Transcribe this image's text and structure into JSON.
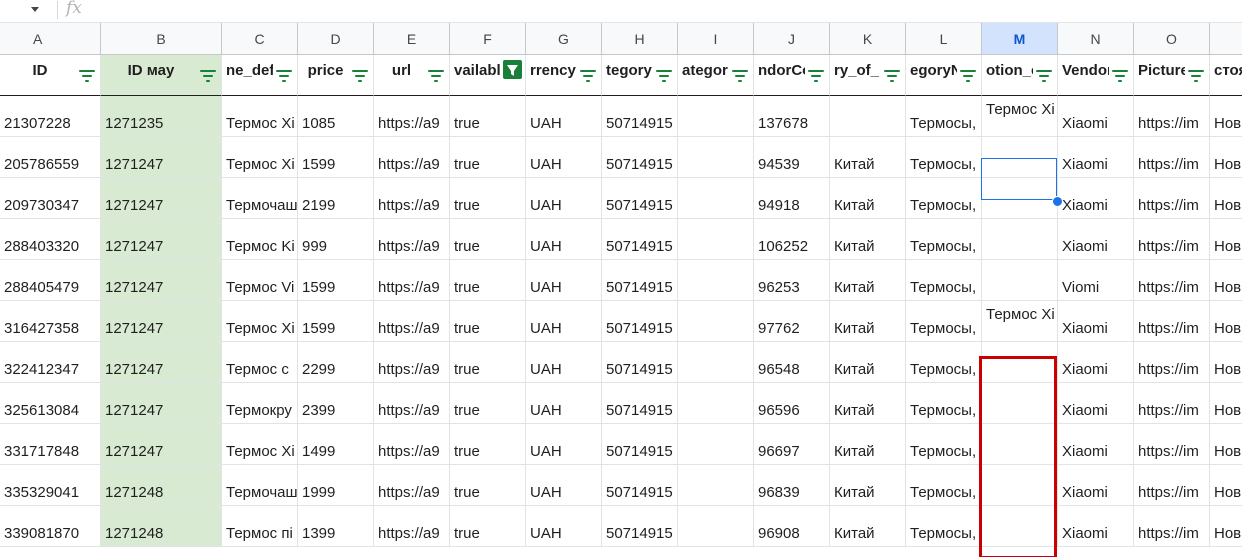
{
  "formula_bar": {
    "fx_label": "fx",
    "value": ""
  },
  "columns": [
    "A",
    "B",
    "C",
    "D",
    "E",
    "F",
    "G",
    "H",
    "I",
    "J",
    "K",
    "L",
    "M",
    "N",
    "O",
    ""
  ],
  "selected_column": "M",
  "headers": [
    "ID",
    "ID мау",
    "ne_def",
    "price",
    "url",
    "vailabl",
    "rrency",
    "tegory",
    "ategor",
    "ndorCo",
    "ry_of_",
    "egoryNa",
    "otion_c",
    "Vendor",
    "Picture:",
    "стоя"
  ],
  "filtered_column": "F",
  "rows": [
    [
      "21307228",
      "1271235",
      "Термос Xi",
      "1085",
      "https://a9",
      "true",
      "UAH",
      "50714915",
      "",
      "137678",
      "",
      "Термосы,",
      "Термос Xi",
      "Xiaomi",
      "https://im",
      "Нов"
    ],
    [
      "205786559",
      "1271247",
      "Термос Xi",
      "1599",
      "https://a9",
      "true",
      "UAH",
      "50714915",
      "",
      "94539",
      "Китай",
      "Термосы,",
      "",
      "Xiaomi",
      "https://im",
      "Нов"
    ],
    [
      "209730347",
      "1271247",
      "Термочаш",
      "2199",
      "https://a9",
      "true",
      "UAH",
      "50714915",
      "",
      "94918",
      "Китай",
      "Термосы,",
      "",
      "Xiaomi",
      "https://im",
      "Нов"
    ],
    [
      "288403320",
      "1271247",
      "Термос Ki",
      "999",
      "https://a9",
      "true",
      "UAH",
      "50714915",
      "",
      "106252",
      "Китай",
      "Термосы,",
      "",
      "Xiaomi",
      "https://im",
      "Нов"
    ],
    [
      "288405479",
      "1271247",
      "Термос Vi",
      "1599",
      "https://a9",
      "true",
      "UAH",
      "50714915",
      "",
      "96253",
      "Китай",
      "Термосы,",
      "",
      "Viomi",
      "https://im",
      "Нов"
    ],
    [
      "316427358",
      "1271247",
      "Термос Xi",
      "1599",
      "https://a9",
      "true",
      "UAH",
      "50714915",
      "",
      "97762",
      "Китай",
      "Термосы,",
      "Термос Xi",
      "Xiaomi",
      "https://im",
      "Нов"
    ],
    [
      "322412347",
      "1271247",
      "Термос с",
      "2299",
      "https://a9",
      "true",
      "UAH",
      "50714915",
      "",
      "96548",
      "Китай",
      "Термосы,",
      "",
      "Xiaomi",
      "https://im",
      "Нов"
    ],
    [
      "325613084",
      "1271247",
      "Термокру",
      "2399",
      "https://a9",
      "true",
      "UAH",
      "50714915",
      "",
      "96596",
      "Китай",
      "Термосы,",
      "",
      "Xiaomi",
      "https://im",
      "Нов"
    ],
    [
      "331717848",
      "1271247",
      "Термос Xi",
      "1499",
      "https://a9",
      "true",
      "UAH",
      "50714915",
      "",
      "96697",
      "Китай",
      "Термосы,",
      "",
      "Xiaomi",
      "https://im",
      "Нов"
    ],
    [
      "335329041",
      "1271248",
      "Термочаш",
      "1999",
      "https://a9",
      "true",
      "UAH",
      "50714915",
      "",
      "96839",
      "Китай",
      "Термосы,",
      "",
      "Xiaomi",
      "https://im",
      "Нов"
    ],
    [
      "339081870",
      "1271248",
      "Термос пі",
      "1399",
      "https://a9",
      "true",
      "UAH",
      "50714915",
      "",
      "96908",
      "Китай",
      "Термосы,",
      "",
      "Xiaomi",
      "https://im",
      "Нов"
    ]
  ],
  "highlight_column_color": "#d9ead3",
  "selection_color": "#1a73e8",
  "annotation_color": "#cc0000"
}
